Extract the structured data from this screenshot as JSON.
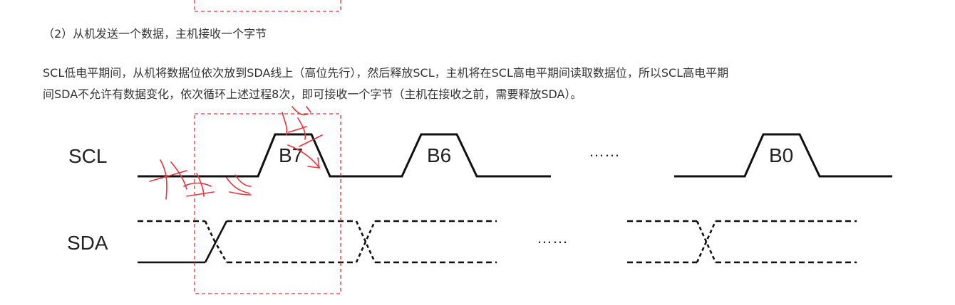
{
  "heading": "（2）从机发送一个数据，主机接收一个字节",
  "paragraph": {
    "line1": "SCL低电平期间，从机将数据位依次放到SDA线上（高位先行），然后释放SCL，主机将在SCL高电平期间读取数据位，所以SCL高电平期",
    "line2": "间SDA不允许有数据变化，依次循环上述过程8次，即可接收一个字节（主机在接收之前，需要释放SDA）。"
  },
  "diagram": {
    "scl_label": "SCL",
    "sda_label": "SDA",
    "bits": [
      "B7",
      "B6",
      "B0"
    ],
    "scl_ellipsis": "……",
    "sda_ellipsis": "……",
    "annotation_color": "#e8323c"
  }
}
